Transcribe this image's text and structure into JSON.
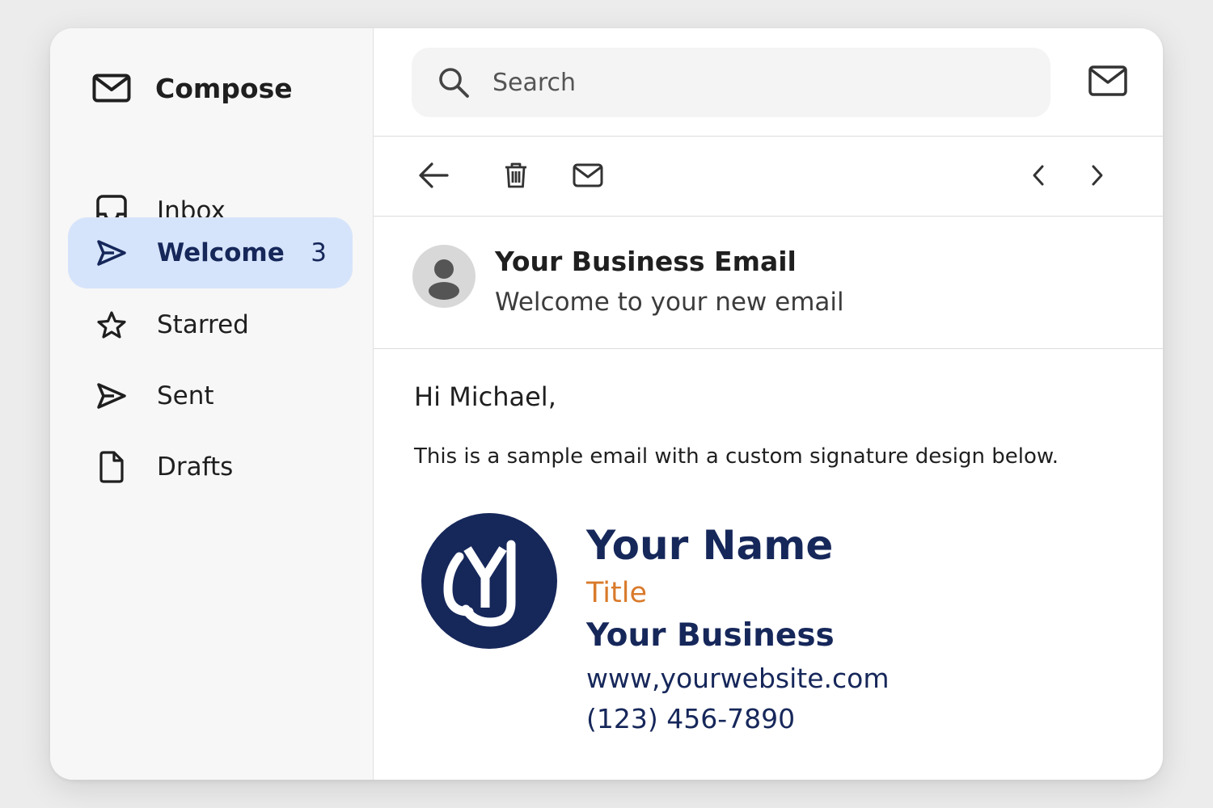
{
  "sidebar": {
    "compose_label": "Compose",
    "items": [
      {
        "label": "Inbox",
        "icon": "inbox-icon"
      },
      {
        "label": "Welcome",
        "icon": "send-icon",
        "count": "3",
        "active": true
      },
      {
        "label": "Starred",
        "icon": "star-icon"
      },
      {
        "label": "Sent",
        "icon": "send-icon"
      },
      {
        "label": "Drafts",
        "icon": "draft-icon"
      }
    ]
  },
  "search": {
    "placeholder": "Search"
  },
  "email": {
    "sender": "Your Business Email",
    "subject": "Welcome to your new email",
    "greeting": "Hi Michael,",
    "body": "This is a sample email with a custom signature design below."
  },
  "signature": {
    "name": "Your Name",
    "title": "Title",
    "business": "Your Business",
    "website": "www,yourwebsite.com",
    "phone": "(123) 456-7890"
  },
  "colors": {
    "accent_navy": "#16275a",
    "accent_orange": "#d97a2b",
    "active_bg": "#d6e4fb",
    "sidebar_bg": "#f7f7f7"
  }
}
